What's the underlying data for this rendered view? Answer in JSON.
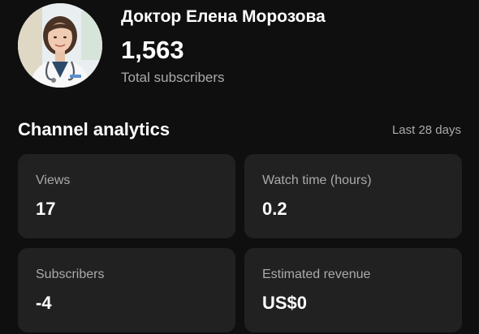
{
  "channel": {
    "name": "Доктор Елена Морозова",
    "subscriber_count": "1,563",
    "subscriber_label": "Total subscribers",
    "avatar_icon": "doctor-portrait"
  },
  "analytics": {
    "title": "Channel analytics",
    "period": "Last 28 days",
    "metrics": [
      {
        "label": "Views",
        "value": "17"
      },
      {
        "label": "Watch time (hours)",
        "value": "0.2"
      },
      {
        "label": "Subscribers",
        "value": "-4"
      },
      {
        "label": "Estimated revenue",
        "value": "US$0"
      }
    ]
  },
  "colors": {
    "background": "#0f0f0f",
    "card": "#212121",
    "primary_text": "#ffffff",
    "secondary_text": "#aaaaaa"
  }
}
